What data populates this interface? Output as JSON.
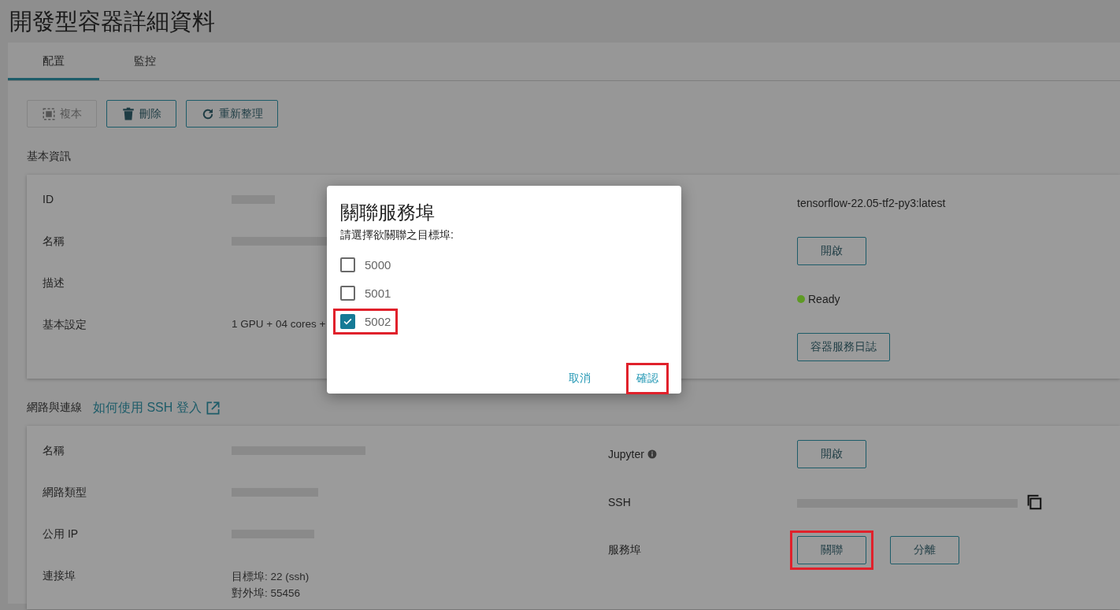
{
  "page_title": "開發型容器詳細資料",
  "tabs": [
    {
      "label": "配置",
      "selected": true
    },
    {
      "label": "監控",
      "selected": false
    }
  ],
  "toolbar": [
    {
      "label": "複本",
      "disabled": true
    },
    {
      "label": "刪除",
      "disabled": false
    },
    {
      "label": "重新整理",
      "disabled": false
    }
  ],
  "sections": [
    {
      "title": "基本資訊",
      "left_rows": [
        {
          "label": "ID",
          "redacted": true
        },
        {
          "label": "名稱",
          "redacted": true
        },
        {
          "label": "描述"
        },
        {
          "label": "基本設定",
          "value": "1 GPU + 04 cores +"
        }
      ],
      "right_rows": [
        {
          "kind": "text",
          "value": "tensorflow-22.05-tf2-py3:latest"
        },
        {
          "kind": "buttons",
          "buttons": [
            {
              "label": "開啟",
              "highlighted": false
            }
          ]
        },
        {
          "kind": "status",
          "value": "Ready",
          "color": "#5e9a24"
        },
        {
          "kind": "buttons",
          "buttons": [
            {
              "label": "容器服務日誌",
              "highlighted": false
            }
          ]
        }
      ]
    },
    {
      "title": "網路與連線",
      "link": "如何使用 SSH 登入",
      "left_rows": [
        {
          "label": "名稱",
          "redacted": true
        },
        {
          "label": "網路類型",
          "redacted": true
        },
        {
          "label": "公用 IP",
          "redacted": true
        },
        {
          "label": "連接埠",
          "lines": [
            "目標埠: 22 (ssh)",
            "對外埠: 55456"
          ]
        }
      ],
      "right_rows": [
        {
          "kind": "buttons",
          "label": "Jupyter",
          "info": true,
          "buttons": [
            {
              "label": "開啟",
              "highlighted": false
            }
          ]
        },
        {
          "kind": "copy",
          "label": "SSH",
          "redacted": true
        },
        {
          "kind": "buttons",
          "label": "服務埠",
          "buttons": [
            {
              "label": "關聯",
              "highlighted": true
            },
            {
              "label": "分離",
              "highlighted": false
            }
          ]
        }
      ]
    }
  ],
  "dialog": {
    "title": "關聯服務埠",
    "prompt": "請選擇欲關聯之目標埠:",
    "options": [
      {
        "label": "5000",
        "checked": false,
        "highlighted": false
      },
      {
        "label": "5001",
        "checked": false,
        "highlighted": false
      },
      {
        "label": "5002",
        "checked": true,
        "highlighted": true
      }
    ],
    "actions": [
      {
        "label": "取消",
        "highlighted": false
      },
      {
        "label": "確認",
        "highlighted": true
      }
    ]
  }
}
